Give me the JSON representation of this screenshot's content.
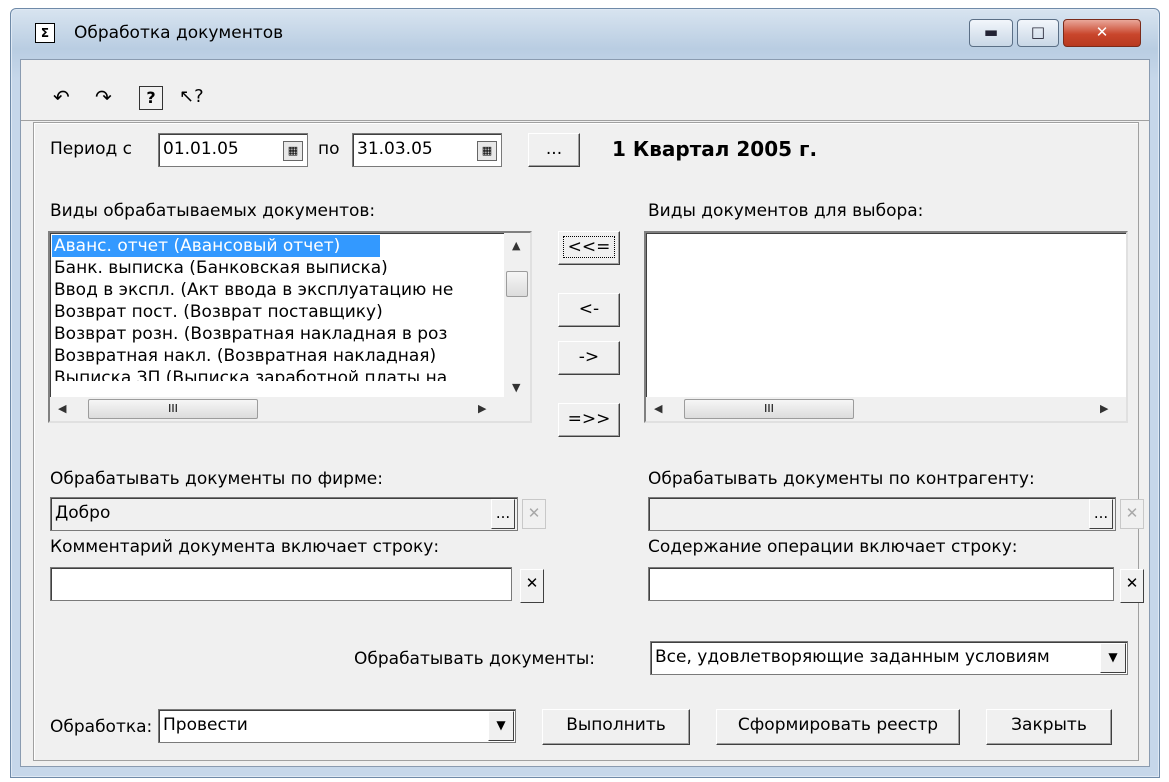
{
  "window": {
    "title": "Обработка документов",
    "icon": "sigma-icon",
    "buttons": {
      "minimize": "▬",
      "maximize": "□",
      "close": "✕"
    }
  },
  "toolbar": {
    "items": [
      "undo-restore-icon",
      "redo-restore-icon",
      "help-icon",
      "context-help-icon"
    ],
    "glyphs": {
      "undo": "↶",
      "redo": "↷",
      "help": "?",
      "context_help": "↖?"
    }
  },
  "period": {
    "label": "Период с",
    "from": "01.01.05",
    "to_label": "по",
    "to": "31.03.05",
    "browse": "...",
    "caption": "1 Квартал 2005 г."
  },
  "processed_docs": {
    "label": "Виды обрабатываемых документов:",
    "items": [
      "Аванс. отчет (Авансовый отчет)",
      "Банк. выписка (Банковская выписка)",
      "Ввод в экспл. (Акт ввода в эксплуатацию не",
      "Возврат пост. (Возврат поставщику)",
      "Возврат розн. (Возвратная накладная в роз",
      "Возвратная накл. (Возвратная накладная)",
      "Выписка ЗП (Выписка заработной платы на"
    ],
    "selected_index": 0,
    "hscroll_thumb": "III"
  },
  "move_buttons": {
    "all_left": "<<=",
    "left": "<-",
    "right": "->",
    "all_right": "=>>"
  },
  "available_docs": {
    "label": "Виды документов для выбора:",
    "hscroll_thumb": "III"
  },
  "firm": {
    "label": "Обрабатывать документы по фирме:",
    "value": "Добро",
    "browse": "...",
    "clear": "✕"
  },
  "contractor": {
    "label": "Обрабатывать документы по контрагенту:",
    "value": "",
    "browse": "...",
    "clear": "✕"
  },
  "comment": {
    "label": "Комментарий документа включает строку:",
    "value": "",
    "clear": "✕"
  },
  "operation": {
    "label": "Содержание операции включает строку:",
    "value": "",
    "clear": "✕"
  },
  "process_mode": {
    "label": "Обрабатывать документы:",
    "value": "Все, удовлетворяющие заданным условиям"
  },
  "processing": {
    "label": "Обработка:",
    "value": "Провести"
  },
  "actions": {
    "execute": "Выполнить",
    "register": "Сформировать реестр",
    "close": "Закрыть"
  }
}
